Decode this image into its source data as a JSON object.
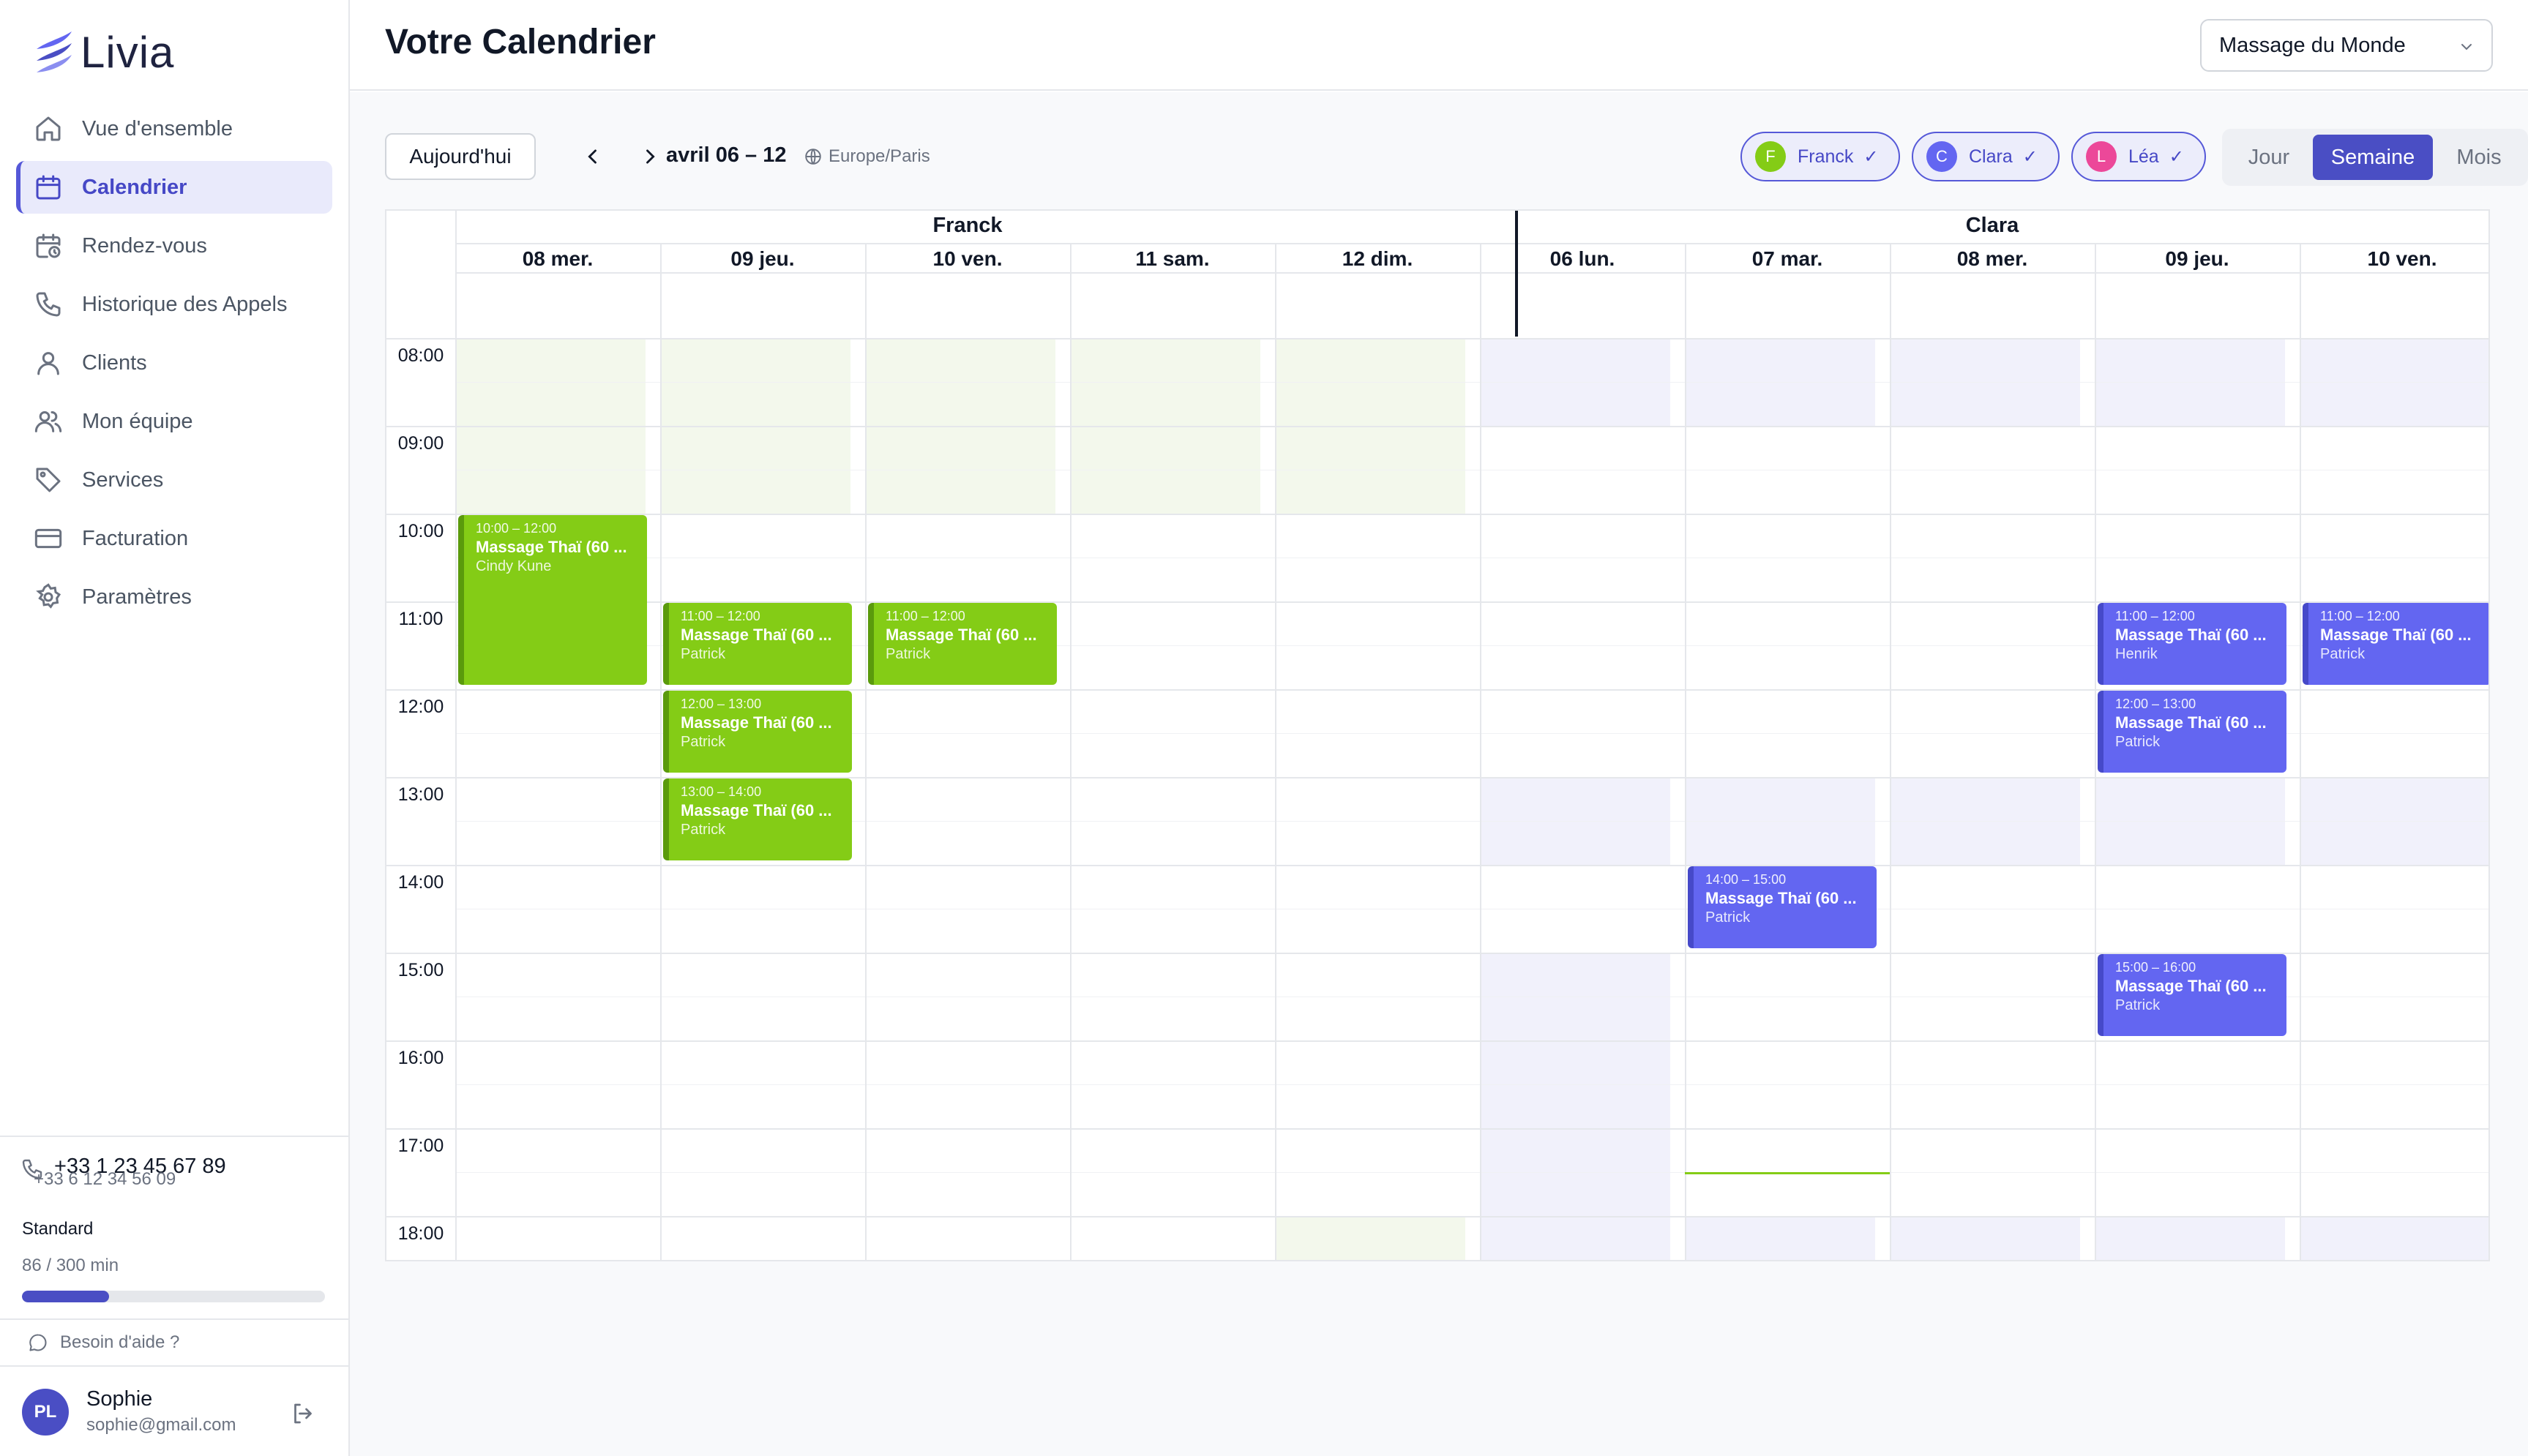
{
  "app": {
    "name": "Livia"
  },
  "sidebar": {
    "items": [
      {
        "label": "Vue d'ensemble",
        "icon": "home-icon",
        "active": false
      },
      {
        "label": "Calendrier",
        "icon": "calendar-icon",
        "active": true
      },
      {
        "label": "Rendez-vous",
        "icon": "calendar-clock-icon",
        "active": false
      },
      {
        "label": "Historique des Appels",
        "icon": "phone-icon",
        "active": false
      },
      {
        "label": "Clients",
        "icon": "user-icon",
        "active": false
      },
      {
        "label": "Mon équipe",
        "icon": "users-icon",
        "active": false
      },
      {
        "label": "Services",
        "icon": "tag-icon",
        "active": false
      },
      {
        "label": "Facturation",
        "icon": "credit-card-icon",
        "active": false
      },
      {
        "label": "Paramètres",
        "icon": "gear-icon",
        "active": false
      }
    ],
    "phone_main": "+33 1 23 45 67 89",
    "phone_sub": "+33 6 12 34 56 09",
    "plan": "Standard",
    "usage": "86 / 300 min",
    "usage_fraction": 0.287,
    "help": "Besoin d'aide ?",
    "user": {
      "initials": "PL",
      "name": "Sophie",
      "email": "sophie@gmail.com"
    }
  },
  "header": {
    "title": "Votre Calendrier",
    "location_select": "Massage du Monde"
  },
  "toolbar": {
    "today": "Aujourd'hui",
    "range": "avril 06 – 12",
    "timezone": "Europe/Paris",
    "staff_chips": [
      {
        "initial": "F",
        "name": "Franck",
        "color": "#84cc16"
      },
      {
        "initial": "C",
        "name": "Clara",
        "color": "#6366f1"
      },
      {
        "initial": "L",
        "name": "Léa",
        "color": "#ec4899"
      }
    ],
    "views": [
      "Jour",
      "Semaine",
      "Mois"
    ],
    "active_view": "Semaine"
  },
  "calendar": {
    "staff": [
      "Franck",
      "Clara"
    ],
    "days": [
      "08 mer.",
      "09 jeu.",
      "10 ven.",
      "11 sam.",
      "12 dim.",
      "06 lun.",
      "07 mar.",
      "08 mer.",
      "09 jeu.",
      "10 ven."
    ],
    "hours": [
      "08:00",
      "09:00",
      "10:00",
      "11:00",
      "12:00",
      "13:00",
      "14:00",
      "15:00",
      "16:00",
      "17:00",
      "18:00"
    ],
    "colors": {
      "franck": "#84cc16",
      "clara": "#6366f1",
      "accent": "#4a4ec4"
    },
    "events": [
      {
        "day": 0,
        "start": 10,
        "end": 12,
        "time": "10:00 – 12:00",
        "title": "Massage Thaï (60 ...",
        "client": "Cindy Kune",
        "color": "green"
      },
      {
        "day": 1,
        "start": 11,
        "end": 12,
        "time": "11:00 – 12:00",
        "title": "Massage Thaï (60 ...",
        "client": "Patrick",
        "color": "green"
      },
      {
        "day": 2,
        "start": 11,
        "end": 12,
        "time": "11:00 – 12:00",
        "title": "Massage Thaï (60 ...",
        "client": "Patrick",
        "color": "green"
      },
      {
        "day": 1,
        "start": 12,
        "end": 13,
        "time": "12:00 – 13:00",
        "title": "Massage Thaï (60 ...",
        "client": "Patrick",
        "color": "green"
      },
      {
        "day": 1,
        "start": 13,
        "end": 14,
        "time": "13:00 – 14:00",
        "title": "Massage Thaï (60 ...",
        "client": "Patrick",
        "color": "green"
      },
      {
        "day": 8,
        "start": 11,
        "end": 12,
        "time": "11:00 – 12:00",
        "title": "Massage Thaï (60 ...",
        "client": "Henrik",
        "color": "blue"
      },
      {
        "day": 9,
        "start": 11,
        "end": 12,
        "time": "11:00 – 12:00",
        "title": "Massage Thaï (60 ...",
        "client": "Patrick",
        "color": "blue"
      },
      {
        "day": 8,
        "start": 12,
        "end": 13,
        "time": "12:00 – 13:00",
        "title": "Massage Thaï (60 ...",
        "client": "Patrick",
        "color": "blue"
      },
      {
        "day": 6,
        "start": 14,
        "end": 15,
        "time": "14:00 – 15:00",
        "title": "Massage Thaï (60 ...",
        "client": "Patrick",
        "color": "blue"
      },
      {
        "day": 8,
        "start": 15,
        "end": 16,
        "time": "15:00 – 16:00",
        "title": "Massage Thaï (60 ...",
        "client": "Patrick",
        "color": "blue"
      }
    ]
  }
}
